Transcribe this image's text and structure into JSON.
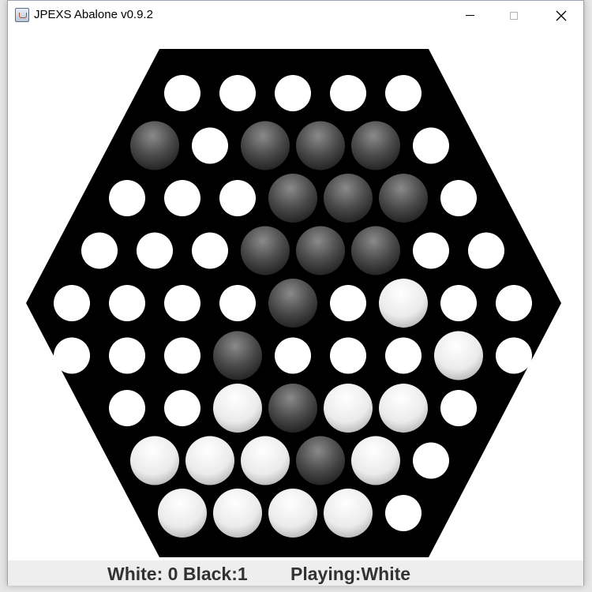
{
  "window": {
    "title": "JPEXS Abalone v0.9.2",
    "buttons": {
      "minimize": "minimize-icon",
      "maximize": "maximize-icon",
      "close": "close-icon"
    }
  },
  "board": {
    "board_color": "#000000",
    "empty_color": "#ffffff",
    "rows": [
      ".....",
      "B.BBB.",
      "...BBB.",
      "...BBB..",
      "....B.W..",
      "...B...W.",
      "..WBWW.",
      "WWWBW.",
      "WWWW."
    ],
    "legend": {
      "B": "black-marble",
      "W": "white-marble",
      ".": "empty-hole"
    }
  },
  "status": {
    "white_label": "White:",
    "white_score": "0",
    "black_label": "Black:",
    "black_score": "1",
    "playing_label": "Playing:",
    "playing_value": "White"
  }
}
